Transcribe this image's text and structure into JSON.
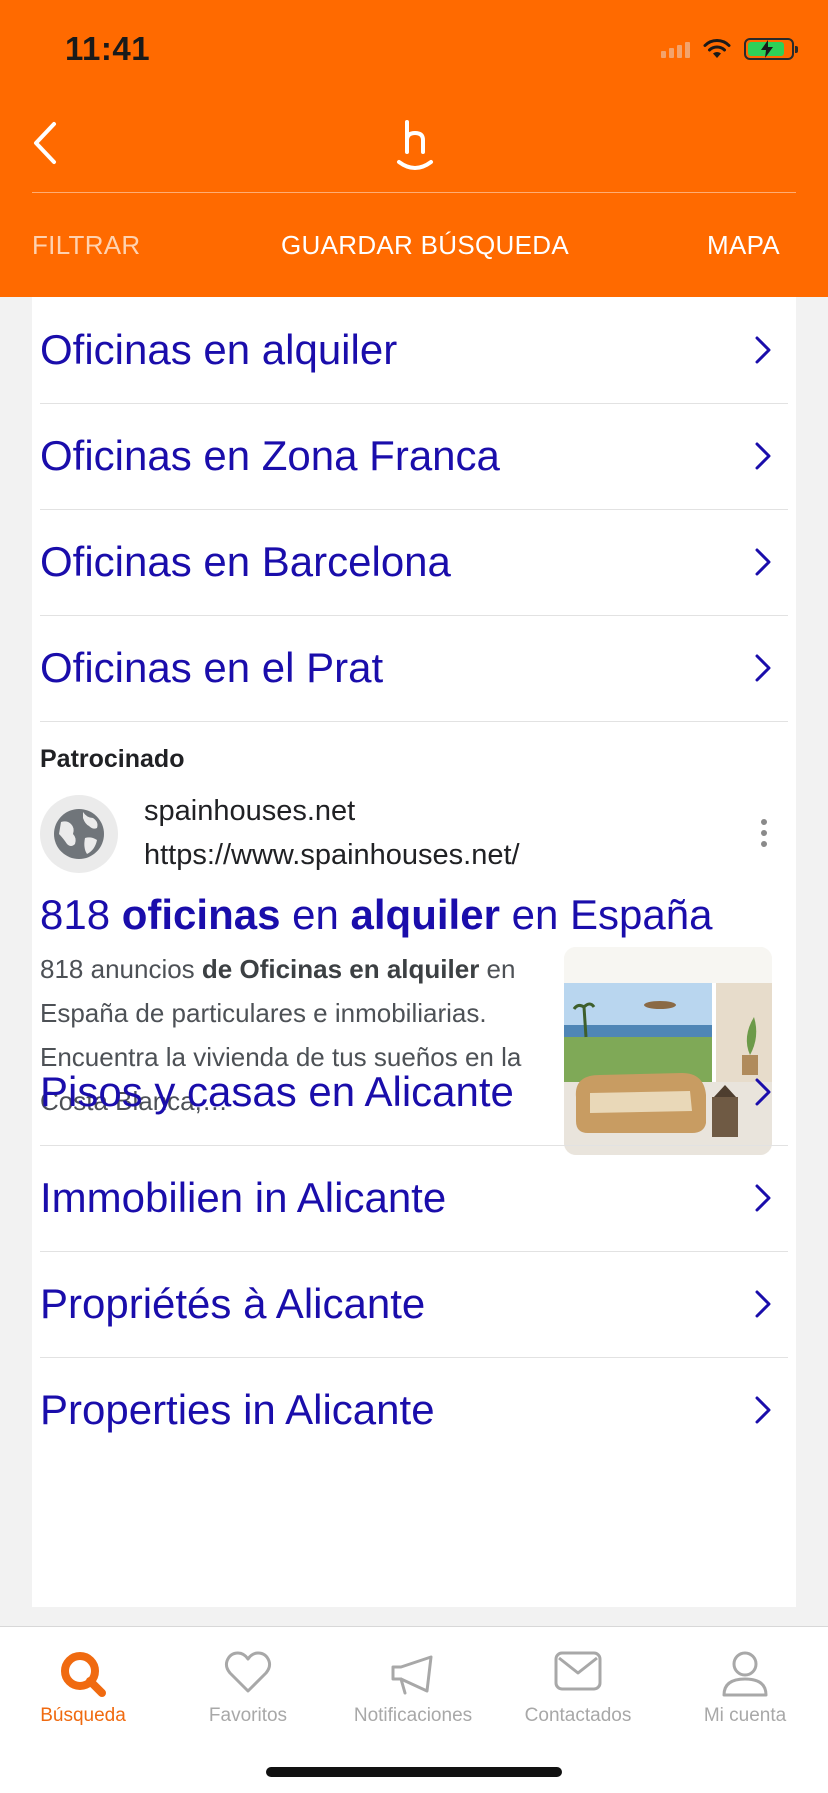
{
  "status_bar": {
    "time": "11:41"
  },
  "header": {
    "actions": {
      "filter": "FILTRAR",
      "save_search": "GUARDAR BÚSQUEDA",
      "map": "MAPA"
    },
    "accent_color": "#ff6a00"
  },
  "related_links_top": [
    {
      "label": "Oficinas en alquiler"
    },
    {
      "label": "Oficinas en Zona Franca"
    },
    {
      "label": "Oficinas en Barcelona"
    },
    {
      "label": "Oficinas en el Prat"
    }
  ],
  "ad": {
    "sponsored_label": "Patrocinado",
    "domain": "spainhouses.net",
    "url": "https://www.spainhouses.net/",
    "title_parts": [
      "818 ",
      "oficinas",
      " en ",
      "alquiler",
      " en España"
    ],
    "description_parts": [
      "818 anuncios ",
      "de Oficinas en alquiler",
      " en España de particulares e inmobiliarias. Encuentra la vivienda de tus sueños en la Costa Blanca,…"
    ],
    "icons": {
      "favicon": "globe-icon",
      "menu": "more-vertical-icon"
    }
  },
  "related_links_bottom": [
    {
      "label": "Pisos y casas en Alicante"
    },
    {
      "label": "Immobilien in Alicante"
    },
    {
      "label": "Propriétés à Alicante"
    },
    {
      "label": "Properties in Alicante"
    }
  ],
  "tabbar": {
    "items": [
      {
        "label": "Búsqueda",
        "icon": "search-icon",
        "active": true
      },
      {
        "label": "Favoritos",
        "icon": "heart-icon",
        "active": false
      },
      {
        "label": "Notificaciones",
        "icon": "megaphone-icon",
        "active": false
      },
      {
        "label": "Contactados",
        "icon": "envelope-icon",
        "active": false
      },
      {
        "label": "Mi cuenta",
        "icon": "user-icon",
        "active": false
      }
    ],
    "active_color": "#f06a10"
  }
}
